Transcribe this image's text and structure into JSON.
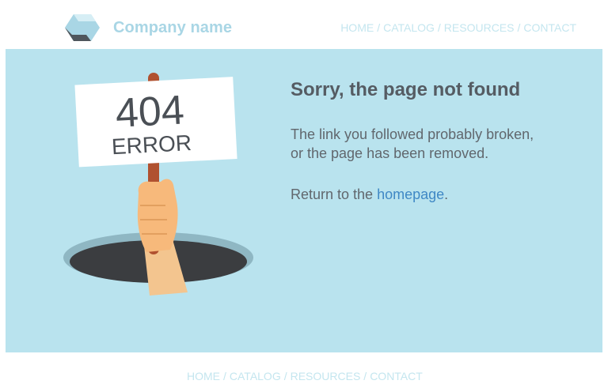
{
  "header": {
    "brand": "Company name",
    "logo_icon": "hexagon-logo-icon",
    "nav": [
      "HOME",
      "CATALOG",
      "RESOURCES",
      "CONTACT"
    ],
    "separator": "/"
  },
  "main": {
    "sign": {
      "code": "404",
      "label": "ERROR"
    },
    "title": "Sorry, the page not found",
    "description_line1": "The link you followed probably broken,",
    "description_line2": "or the page has been removed.",
    "return_prefix": "Return to the ",
    "return_link": "homepage",
    "return_suffix": "."
  },
  "footer": {
    "nav": [
      "HOME",
      "CATALOG",
      "RESOURCES",
      "CONTACT"
    ],
    "separator": "/"
  },
  "colors": {
    "panel_bg": "#b9e3ee",
    "brand": "#a9d6e5",
    "nav": "#c4e6ef",
    "link": "#3f88c5",
    "text": "#61676d"
  }
}
